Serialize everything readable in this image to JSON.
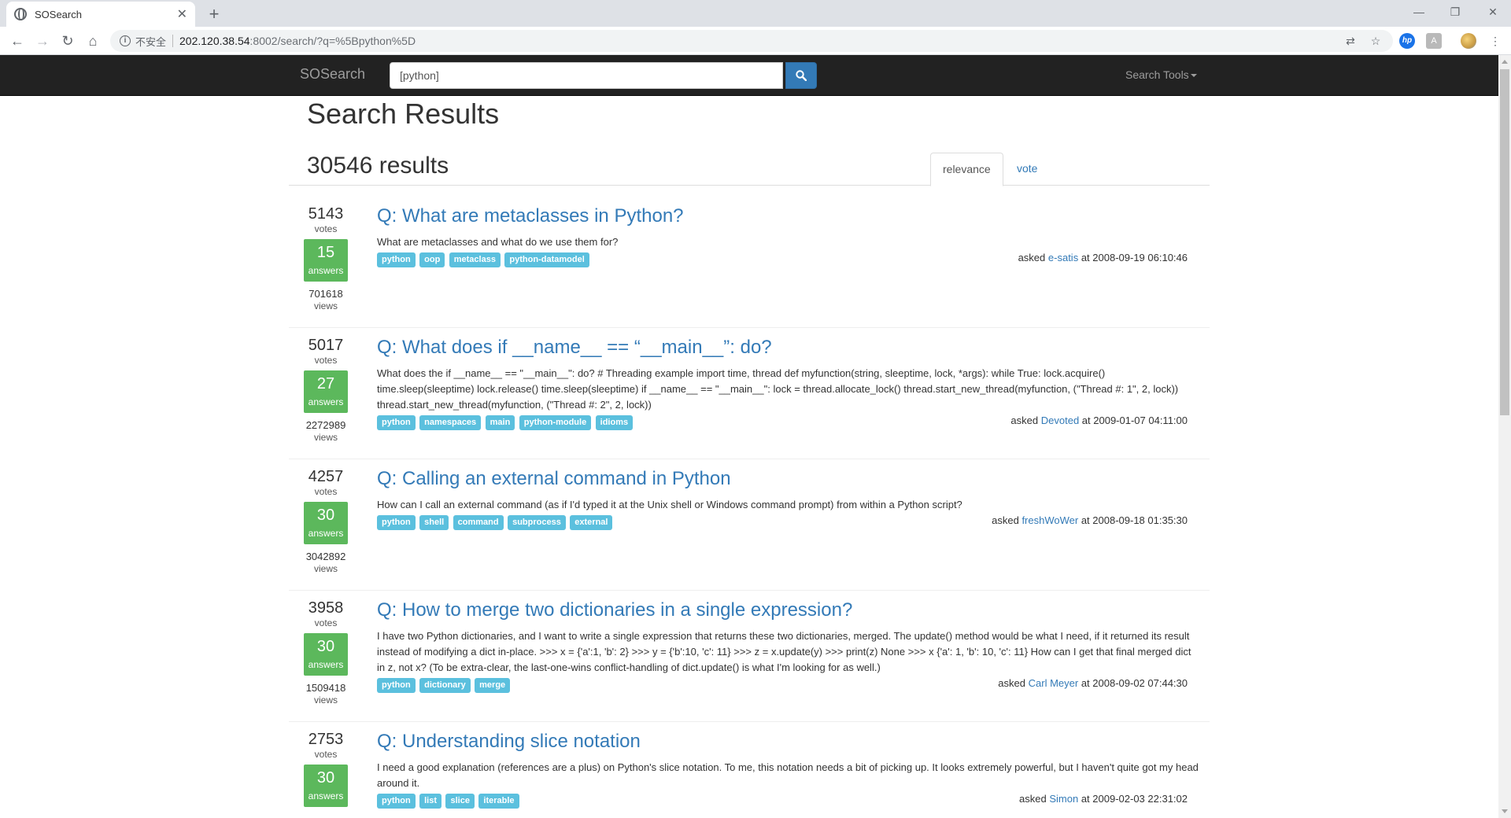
{
  "browser": {
    "tab_title": "SOSearch",
    "tab_close": "✕",
    "new_tab": "+",
    "security_label": "不安全",
    "url_host": "202.120.38.54",
    "url_rest": ":8002/search/?q=%5Bpython%5D",
    "window_controls": [
      "—",
      "❐",
      "✕"
    ],
    "icons": [
      "translate-icon",
      "star-icon",
      "hp-icon",
      "pdf-icon",
      "avatar-icon",
      "menu-icon"
    ]
  },
  "navbar": {
    "brand": "SOSearch",
    "search_value": "[python]",
    "tools_label": "Search Tools",
    "colors": {
      "bar": "#222222",
      "button": "#337ab7"
    }
  },
  "page": {
    "title": "Search Results",
    "count": "30546 results",
    "sort_tabs": [
      "relevance",
      "vote"
    ],
    "active_sort": "relevance"
  },
  "questions": [
    {
      "votes": "5143",
      "votes_label": "votes",
      "answers": "15",
      "answers_label": "answers",
      "views": "701618",
      "views_label": "views",
      "title": "Q: What are metaclasses in Python?",
      "excerpt": "What are metaclasses and what do we use them for?",
      "tags": [
        "python",
        "oop",
        "metaclass",
        "python-datamodel"
      ],
      "asked_prefix": "asked",
      "user": "e-satis",
      "date": "at 2008-09-19 06:10:46"
    },
    {
      "votes": "5017",
      "votes_label": "votes",
      "answers": "27",
      "answers_label": "answers",
      "views": "2272989",
      "views_label": "views",
      "title": "Q: What does if __name__ == “__main__”: do?",
      "excerpt": "What does the if __name__ == \"__main__\": do? # Threading example import time, thread def myfunction(string, sleeptime, lock, *args): while True: lock.acquire() time.sleep(sleeptime) lock.release() time.sleep(sleeptime) if __name__ == \"__main__\": lock = thread.allocate_lock() thread.start_new_thread(myfunction, (\"Thread #: 1\", 2, lock)) thread.start_new_thread(myfunction, (\"Thread #: 2\", 2, lock))",
      "tags": [
        "python",
        "namespaces",
        "main",
        "python-module",
        "idioms"
      ],
      "asked_prefix": "asked",
      "user": "Devoted",
      "date": "at 2009-01-07 04:11:00"
    },
    {
      "votes": "4257",
      "votes_label": "votes",
      "answers": "30",
      "answers_label": "answers",
      "views": "3042892",
      "views_label": "views",
      "title": "Q: Calling an external command in Python",
      "excerpt": "How can I call an external command (as if I'd typed it at the Unix shell or Windows command prompt) from within a Python script?",
      "tags": [
        "python",
        "shell",
        "command",
        "subprocess",
        "external"
      ],
      "asked_prefix": "asked",
      "user": "freshWoWer",
      "date": "at 2008-09-18 01:35:30"
    },
    {
      "votes": "3958",
      "votes_label": "votes",
      "answers": "30",
      "answers_label": "answers",
      "views": "1509418",
      "views_label": "views",
      "title": "Q: How to merge two dictionaries in a single expression?",
      "excerpt": "I have two Python dictionaries, and I want to write a single expression that returns these two dictionaries, merged. The update() method would be what I need, if it returned its result instead of modifying a dict in-place. >>> x = {'a':1, 'b': 2} >>> y = {'b':10, 'c': 11} >>> z = x.update(y) >>> print(z) None >>> x {'a': 1, 'b': 10, 'c': 11} How can I get that final merged dict in z, not x? (To be extra-clear, the last-one-wins conflict-handling of dict.update() is what I'm looking for as well.)",
      "tags": [
        "python",
        "dictionary",
        "merge"
      ],
      "asked_prefix": "asked",
      "user": "Carl Meyer",
      "date": "at 2008-09-02 07:44:30"
    },
    {
      "votes": "2753",
      "votes_label": "votes",
      "answers": "30",
      "answers_label": "answers",
      "views": "",
      "views_label": "",
      "title": "Q: Understanding slice notation",
      "excerpt": "I need a good explanation (references are a plus) on Python's slice notation. To me, this notation needs a bit of picking up. It looks extremely powerful, but I haven't quite got my head around it.",
      "tags": [
        "python",
        "list",
        "slice",
        "iterable"
      ],
      "asked_prefix": "asked",
      "user": "Simon",
      "date": "at 2009-02-03 22:31:02"
    }
  ]
}
